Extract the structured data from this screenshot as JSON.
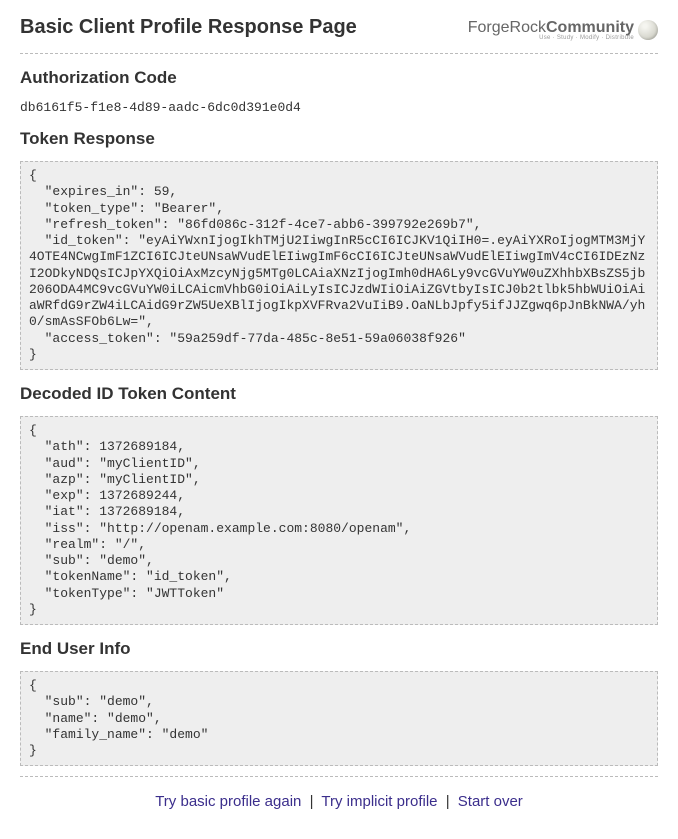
{
  "header": {
    "title": "Basic Client Profile Response Page",
    "brand_part1": "ForgeRock",
    "brand_part2": "Community",
    "brand_sub": "Use · Study · Modify · Distribute"
  },
  "sections": {
    "auth_code": {
      "heading": "Authorization Code",
      "value": "db6161f5-f1e8-4d89-aadc-6dc0d391e0d4"
    },
    "token_response": {
      "heading": "Token Response",
      "body": "{\n  \"expires_in\": 59,\n  \"token_type\": \"Bearer\",\n  \"refresh_token\": \"86fd086c-312f-4ce7-abb6-399792e269b7\",\n  \"id_token\": \"eyAiYWxnIjogIkhTMjU2IiwgInR5cCI6ICJKV1QiIH0=.eyAiYXRoIjogMTM3MjY4OTE4NCwgImF1ZCI6ICJteUNsaWVudElEIiwgImF6cCI6ICJteUNsaWVudElEIiwgImV4cCI6IDEzNzI2ODkyNDQsICJpYXQiOiAxMzcyNjg5MTg0LCAiaXNzIjogImh0dHA6Ly9vcGVuYW0uZXhhbXBsZS5jb206ODA4MC9vcGVuYW0iLCAicmVhbG0iOiAiLyIsICJzdWIiOiAiZGVtbyIsICJ0b2tlbk5hbWUiOiAiaWRfdG9rZW4iLCAidG9rZW5UeXBlIjogIkpXVFRva2VuIiB9.OaNLbJpfy5ifJJZgwq6pJnBkNWA/yh0/smAsSFOb6Lw=\",\n  \"access_token\": \"59a259df-77da-485c-8e51-59a06038f926\"\n}"
    },
    "decoded_id": {
      "heading": "Decoded ID Token Content",
      "body": "{\n  \"ath\": 1372689184,\n  \"aud\": \"myClientID\",\n  \"azp\": \"myClientID\",\n  \"exp\": 1372689244,\n  \"iat\": 1372689184,\n  \"iss\": \"http://openam.example.com:8080/openam\",\n  \"realm\": \"/\",\n  \"sub\": \"demo\",\n  \"tokenName\": \"id_token\",\n  \"tokenType\": \"JWTToken\"\n}"
    },
    "end_user": {
      "heading": "End User Info",
      "body": "{\n  \"sub\": \"demo\",\n  \"name\": \"demo\",\n  \"family_name\": \"demo\"\n}"
    }
  },
  "footer": {
    "basic": "Try basic profile again",
    "implicit": "Try implicit profile",
    "start_over": "Start over",
    "sep": "|"
  }
}
